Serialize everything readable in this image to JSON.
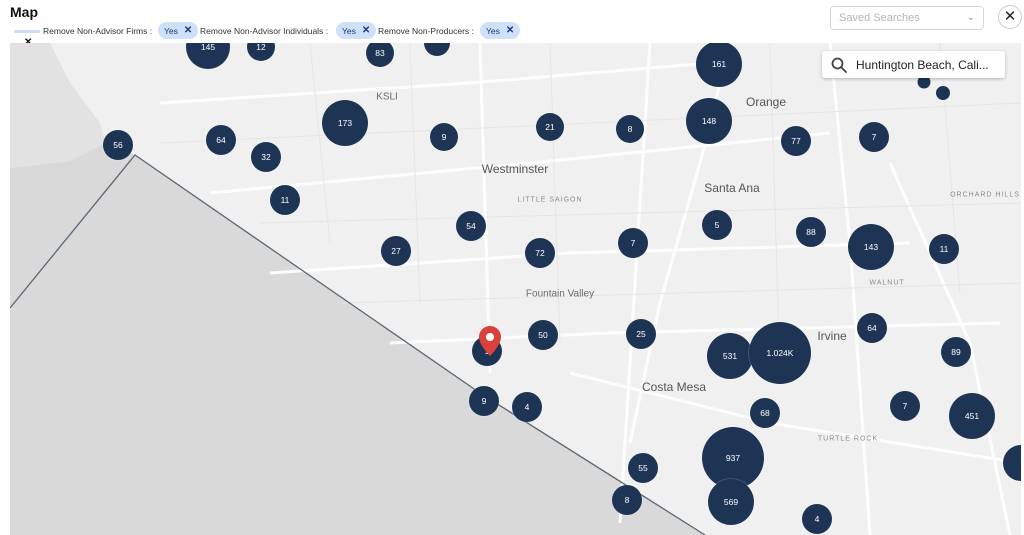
{
  "header": {
    "title": "Map"
  },
  "filters": [
    {
      "label": "Remove Non-Advisor Firms :",
      "value": "Yes"
    },
    {
      "label": "Remove Non-Advisor Individuals :",
      "value": "Yes"
    },
    {
      "label": "Remove Non-Producers :",
      "value": "Yes"
    }
  ],
  "saved_searches": {
    "placeholder": "Saved Searches"
  },
  "map": {
    "search_value": "Huntington Beach, Cali...",
    "places": [
      "Orange",
      "KSLI",
      "Westminster",
      "LITTLE SAIGON",
      "Santa Ana",
      "ORCHARD HILLS",
      "Fountain Valley",
      "WALNUT",
      "Irvine",
      "Costa Mesa",
      "TURTLE ROCK"
    ],
    "clusters": [
      "145",
      "12",
      "83",
      "161",
      "173",
      "9",
      "21",
      "8",
      "148",
      "77",
      "7",
      "56",
      "64",
      "32",
      "11",
      "54",
      "27",
      "72",
      "7",
      "5",
      "88",
      "143",
      "11",
      "64",
      "50",
      "25",
      "1",
      "531",
      "1.024K",
      "89",
      "9",
      "4",
      "68",
      "7",
      "451",
      "937",
      "55",
      "8",
      "569",
      "4"
    ]
  },
  "colors": {
    "cluster": "#1e3455",
    "water": "#d9d9d9",
    "land": "#f0f0f0",
    "chip": "#cfe0fb",
    "pin": "#d9413a"
  }
}
